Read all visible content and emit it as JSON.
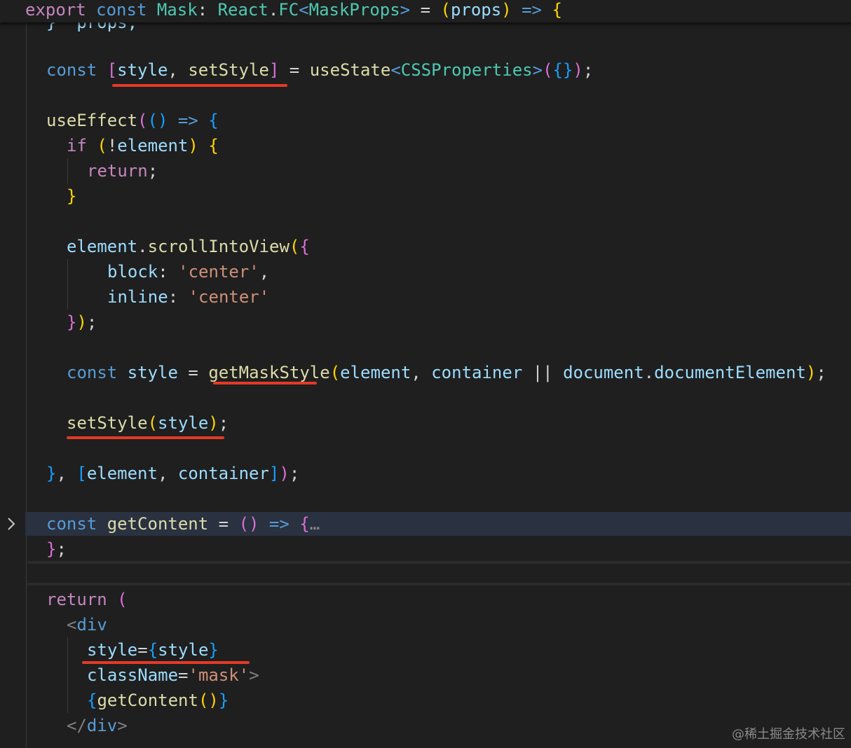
{
  "editor": {
    "sticky_header": [
      "export",
      "const",
      "Mask",
      ": ",
      "React",
      ".",
      "FC",
      "<",
      "MaskProps",
      ">",
      " = ",
      "(",
      "props",
      ")",
      " => ",
      "{"
    ],
    "partial_line": "}  props;",
    "lines": {
      "l1": [
        "const",
        "[",
        "style",
        ", ",
        "setStyle",
        "]",
        " = ",
        "useState",
        "<",
        "CSSProperties",
        ">",
        "(",
        "{",
        "}",
        ")",
        ";"
      ],
      "l2": [
        "useEffect",
        "(",
        "(",
        ")",
        " => ",
        "{"
      ],
      "l3": [
        "if",
        " (",
        "!",
        "element",
        ")",
        " {"
      ],
      "l4": [
        "return",
        ";"
      ],
      "l5": [
        "}"
      ],
      "l6": [
        "element",
        ".",
        "scrollIntoView",
        "(",
        "{"
      ],
      "l7": [
        "block",
        ": ",
        "'center'",
        ","
      ],
      "l8": [
        "inline",
        ": ",
        "'center'"
      ],
      "l9": [
        "}",
        ")",
        ";"
      ],
      "l10": [
        "const",
        "style",
        " = ",
        "getMaskStyle",
        "(",
        "element",
        ", ",
        "container",
        " || ",
        "document",
        ".",
        "documentElement",
        ")",
        ";"
      ],
      "l11": [
        "setStyle",
        "(",
        "style",
        ")",
        ";"
      ],
      "l12": [
        "}",
        ", ",
        "[",
        "element",
        ", ",
        "container",
        "]",
        ")",
        ";"
      ],
      "l13": [
        "const",
        "getContent",
        " = ",
        "(",
        ")",
        " => ",
        "{",
        "…"
      ],
      "l14": [
        "}",
        ";"
      ],
      "l15": [
        "return",
        " ("
      ],
      "l16": [
        "<",
        "div"
      ],
      "l17": [
        "style",
        "=",
        "{",
        "style",
        "}"
      ],
      "l18": [
        "className",
        "=",
        "'mask'",
        ">"
      ],
      "l19": [
        "{",
        "getContent",
        "(",
        ")",
        "}"
      ],
      "l20": [
        "</",
        "div",
        ">"
      ]
    },
    "fold_icon": "chevron-right-icon",
    "annotation_color": "#e53927"
  },
  "watermark": "@稀土掘金技术社区"
}
